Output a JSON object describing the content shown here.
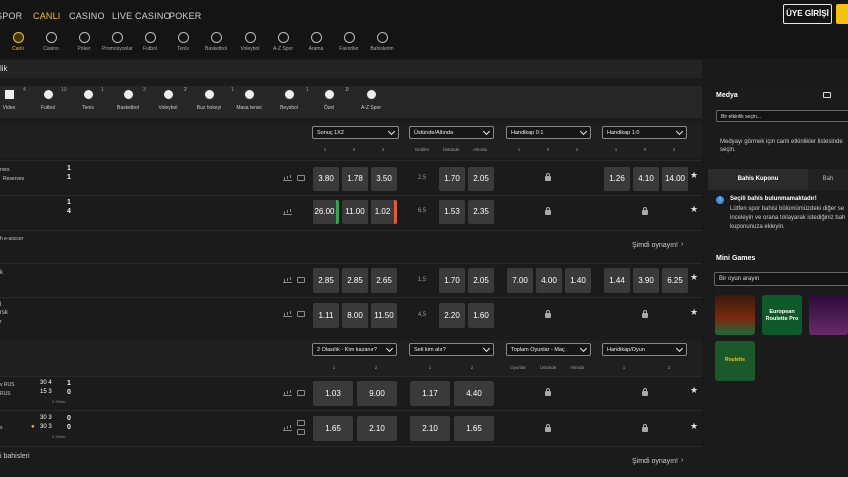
{
  "topnav": {
    "items": [
      "SPOR",
      "CANLI",
      "CASINO",
      "LIVE CASINO",
      "POKER"
    ],
    "register": "ÜYE GİRİŞİ"
  },
  "iconbar": {
    "items": [
      "Canlı",
      "Casino",
      "Poker",
      "Promosyonlar",
      "Futbol",
      "Tenis",
      "Basketbol",
      "Voleybol",
      "A-Z Spor",
      "Arama",
      "Favoriler",
      "Bahislerim"
    ]
  },
  "breadcrumb": "lik",
  "filters": [
    {
      "label": "Video",
      "count": "4"
    },
    {
      "label": "Futbol",
      "count": "10"
    },
    {
      "label": "Tenis",
      "count": "1"
    },
    {
      "label": "Basketbol",
      "count": "3"
    },
    {
      "label": "Voleybol",
      "count": "2"
    },
    {
      "label": "Buz hokeyi",
      "count": "7"
    },
    {
      "label": "Masa tenisi",
      "count": "1"
    },
    {
      "label": "Beyzbol",
      "count": "1"
    },
    {
      "label": "Özel",
      "count": "1"
    },
    {
      "label": "A-Z Spor",
      "count": "3"
    }
  ],
  "sect1": {
    "dropdowns": [
      "Sonuç 1X2",
      "Üstünde/Altında",
      "Handikap 0:1",
      "Handikap 1:0"
    ],
    "cols": [
      "1",
      "X",
      "2",
      "Gediler",
      "Üstünde",
      "Altında",
      "1",
      "X",
      "2",
      "1",
      "X",
      "2"
    ],
    "rows": [
      {
        "team1": "rves",
        "team2": "Reserves",
        "s1": "1",
        "s2": "1",
        "o1": "3.80",
        "o2": "1.78",
        "o3": "3.50",
        "line": "2,5",
        "ou1": "1.70",
        "ou2": "2.05",
        "h1": "1.26",
        "h2": "4.10",
        "h3": "14.00"
      },
      {
        "team1": "",
        "team2": "",
        "s1": "1",
        "s2": "4",
        "o1": "26.00",
        "o2": "11.00",
        "o3": "1.02",
        "line": "6,5",
        "ou1": "1.53",
        "ou2": "2.35"
      }
    ],
    "league": "h e-soccer",
    "more": "Şimdi oynayın!",
    "rows2": [
      {
        "team1": "k",
        "team2": "",
        "o1": "2.85",
        "o2": "2.85",
        "o3": "2.65",
        "line": "1,5",
        "ou1": "1.70",
        "ou2": "2.05",
        "ha1": "7.00",
        "ha2": "4.00",
        "ha3": "1.40",
        "h1": "1.44",
        "h2": "3.90",
        "h3": "6.25"
      },
      {
        "team1": "l",
        "team2": "rsk",
        "team3": "r",
        "o1": "1.11",
        "o2": "8.00",
        "o3": "11.50",
        "line": "4,5",
        "ou1": "2.20",
        "ou2": "1.60"
      }
    ]
  },
  "sect2": {
    "dropdowns": [
      "2 Olasılık - Kim kazanır?",
      "Seti kim alır?",
      "Toplam Oyunlar - Maç",
      "Handikap/Oyun"
    ],
    "cols": [
      "1",
      "2",
      "1",
      "2",
      "Oyunlar",
      "Üstünde",
      "Altında",
      "1",
      "2"
    ],
    "rows": [
      {
        "team1": "v RUS",
        "team2": "RUS",
        "sets1": "30 4",
        "sets2": "15 3",
        "g1": "1",
        "g2": "0",
        "meta": "0 Setler",
        "o1": "1.03",
        "o2": "9.00",
        "s1": "1.17",
        "s2": "4.40"
      },
      {
        "team1": "",
        "team2": "s",
        "sets1": "30 3",
        "sets2": "30 3",
        "g1": "0",
        "g2": "0",
        "meta": "0 Setler",
        "o1": "1.65",
        "o2": "2.10",
        "s1": "2.10",
        "s2": "1.65"
      }
    ],
    "footer": "i bahisleri",
    "more": "Şimdi oynayın!"
  },
  "right": {
    "media_title": "Medya",
    "media_select": "Bir etkinlik seçin...",
    "media_text": [
      "Medyayı görmek için canlı etkinlikler listesinde",
      "seçin."
    ],
    "tab_coupon": "Bahis Kuponu",
    "tab_other": "Bah",
    "notice_title": "Seçili bahis bulunmamaktadır!",
    "notice_text": [
      "Lütfen spor bahisi bölümümüzdeki diğer se",
      "inceleyin ve orana tıklayarak istediğiniz bah",
      "kuponunuza ekleyin."
    ],
    "mini_title": "Mini Games",
    "mini_search": "Bir oyun arayın",
    "games": [
      "European Roulette Pro",
      "Roulette"
    ]
  },
  "colors": {
    "accent": "#f4c20d",
    "bg": "#1a1a1a",
    "odd": "#3a3a3a"
  }
}
